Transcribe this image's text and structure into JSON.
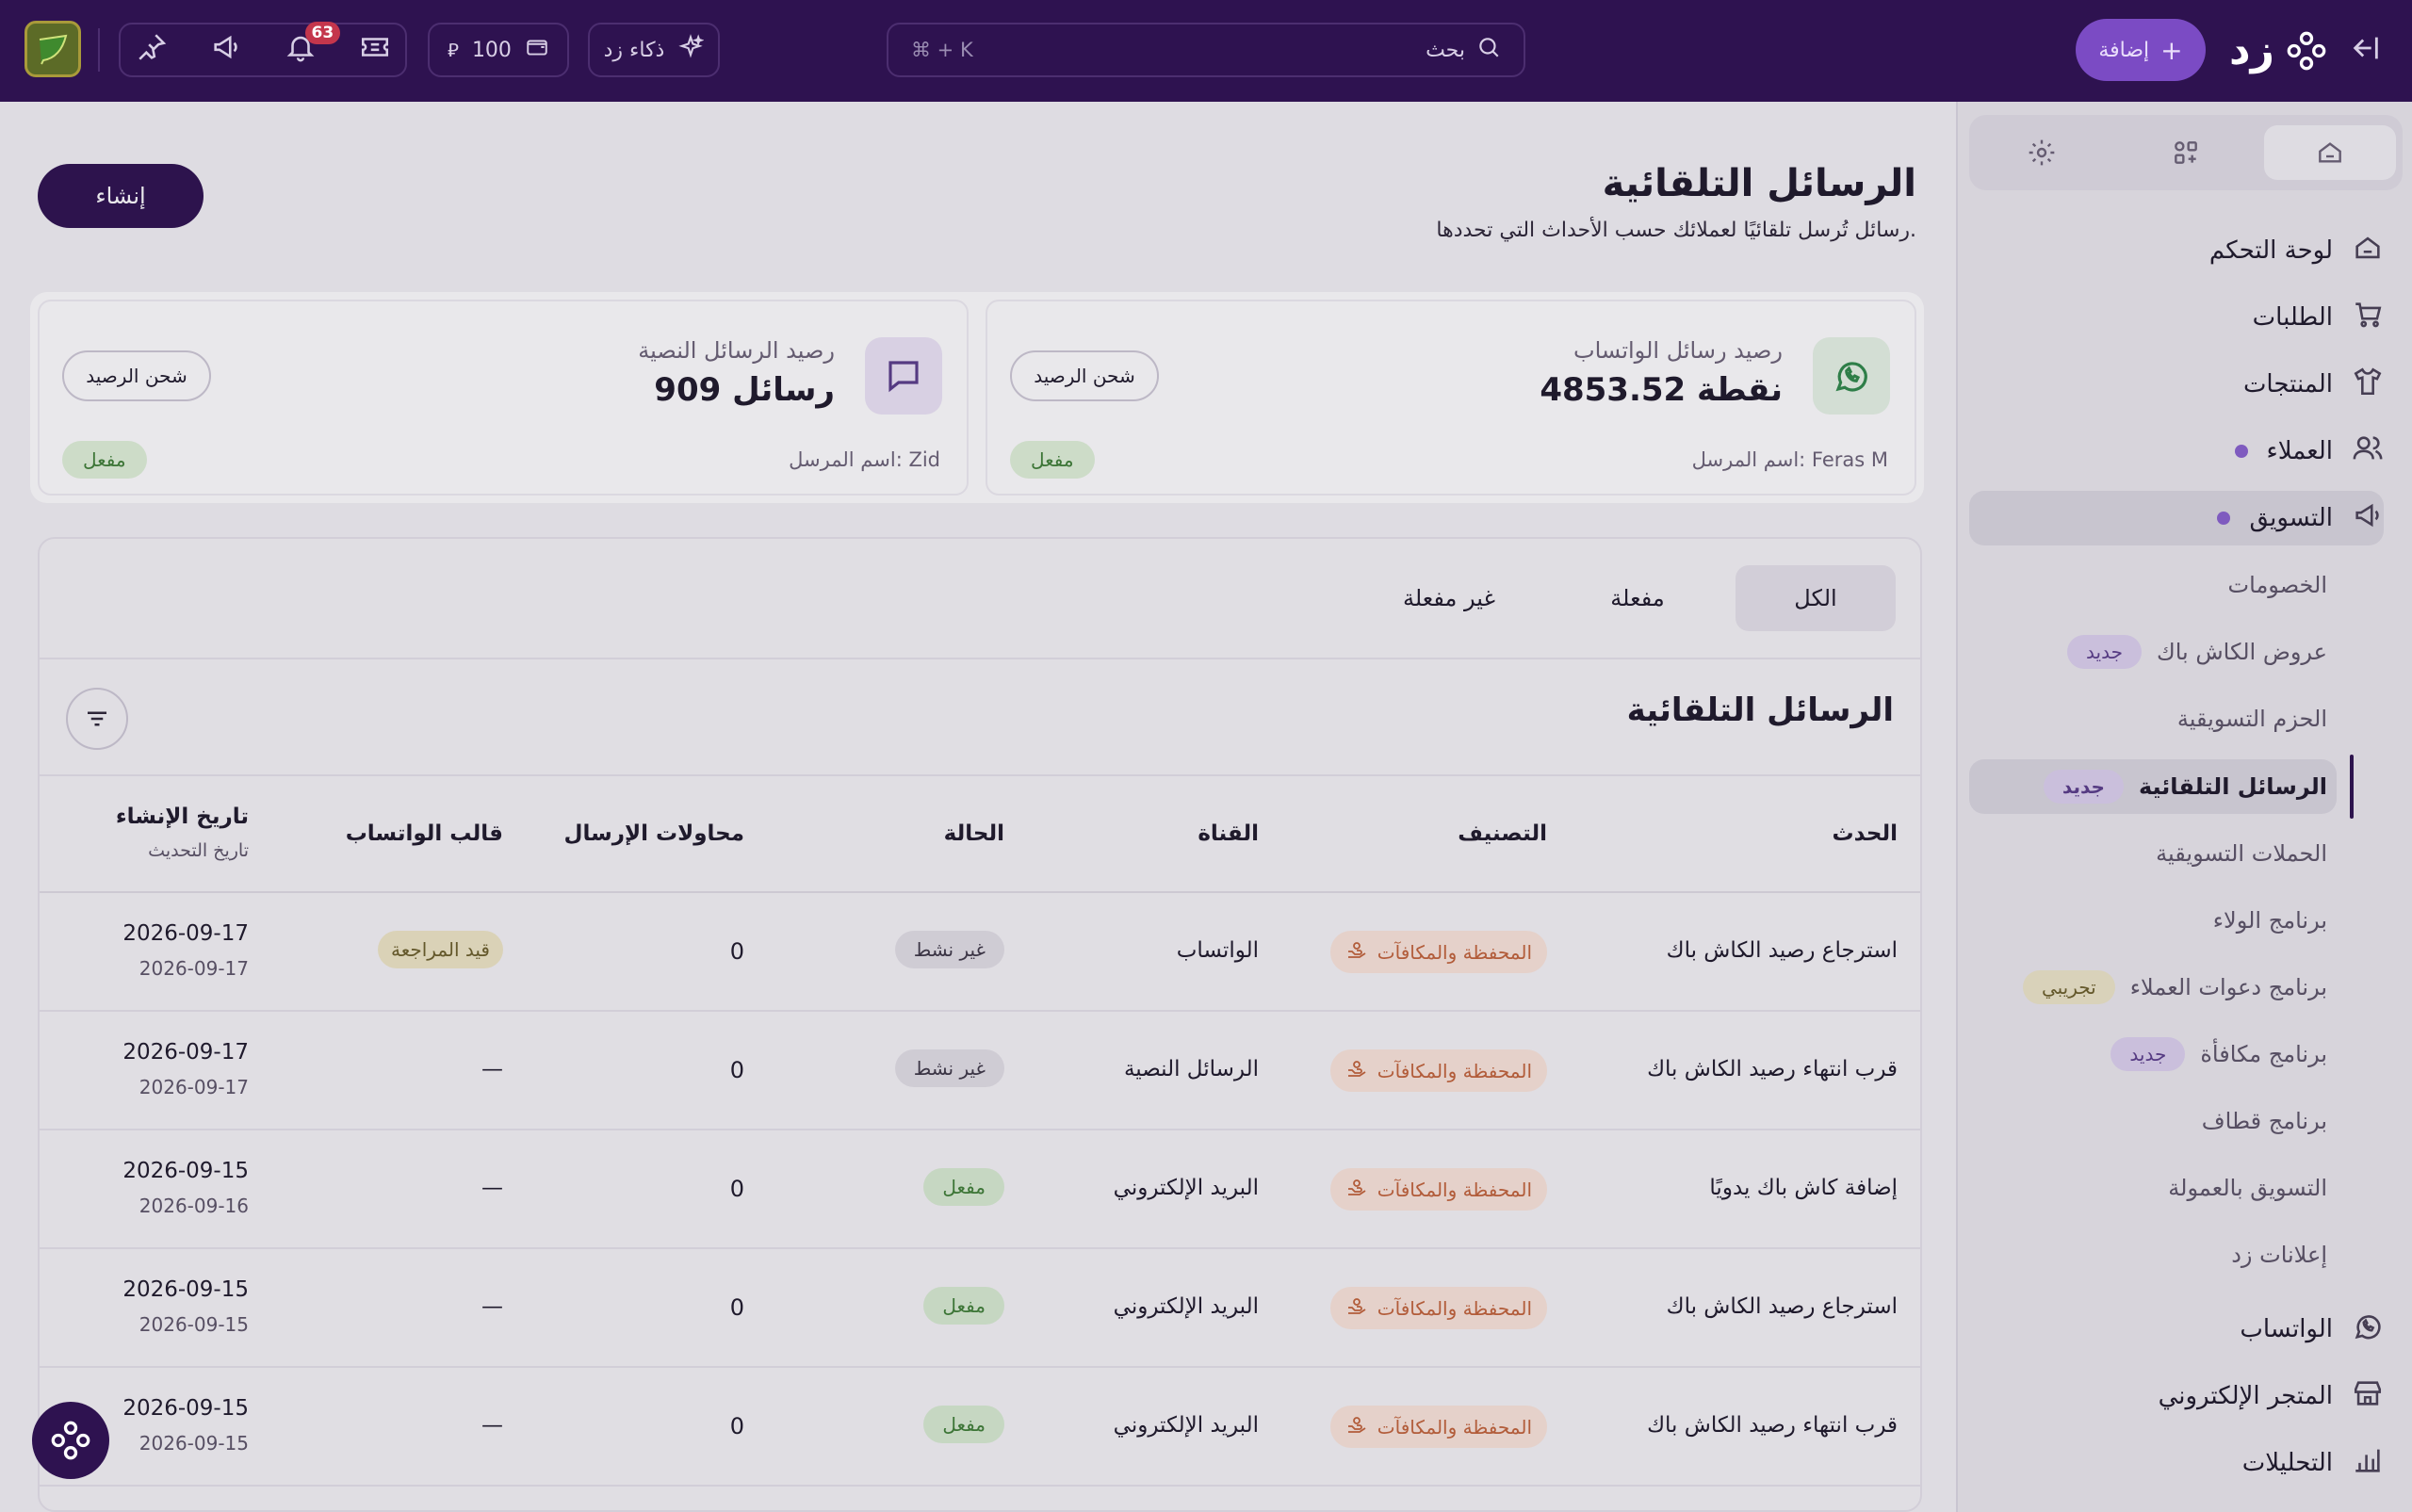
{
  "topbar": {
    "search_placeholder": "بحث",
    "search_shortcut": "⌘ + K",
    "add_label": "إضافة",
    "logo_text": "زد",
    "ai_label": "ذكاء زد",
    "balance_value": "100",
    "notifications_count": "63"
  },
  "sidebar": {
    "items": [
      {
        "label": "لوحة التحكم"
      },
      {
        "label": "الطلبات"
      },
      {
        "label": "المنتجات"
      },
      {
        "label": "العملاء"
      },
      {
        "label": "التسويق"
      }
    ],
    "marketing_sub": [
      {
        "label": "الخصومات"
      },
      {
        "label": "عروض الكاش باك",
        "badge": "جديد"
      },
      {
        "label": "الحزم التسويقية"
      },
      {
        "label": "الرسائل التلقائية",
        "badge": "جديد"
      },
      {
        "label": "الحملات التسويقية"
      },
      {
        "label": "برنامج الولاء"
      },
      {
        "label": "برنامج دعوات العملاء",
        "badge": "تجريبي"
      },
      {
        "label": "برنامج مكافأة",
        "badge": "جديد"
      },
      {
        "label": "برنامج قطاف"
      },
      {
        "label": "التسويق بالعمولة"
      },
      {
        "label": "إعلانات زد"
      }
    ],
    "bottom_items": [
      {
        "label": "الواتساب"
      },
      {
        "label": "المتجر الإلكتروني"
      },
      {
        "label": "التحليلات"
      }
    ]
  },
  "page": {
    "title": "الرسائل التلقائية",
    "subtitle": "رسائل تُرسل تلقائيًا لعملائك حسب الأحداث التي تحددها.",
    "create_label": "إنشاء"
  },
  "cards": {
    "whatsapp": {
      "label": "رصيد رسائل الواتساب",
      "value": "4853.52 نقطة",
      "sender": "اسم المرسل: Feras M",
      "charge_label": "شحن الرصيد",
      "status": "مفعل"
    },
    "sms": {
      "label": "رصيد الرسائل النصية",
      "value": "909 رسائل",
      "sender": "اسم المرسل: Zid",
      "charge_label": "شحن الرصيد",
      "status": "مفعل"
    }
  },
  "filters": {
    "all": "الكل",
    "active": "مفعلة",
    "inactive": "غير مفعلة"
  },
  "table": {
    "title": "الرسائل التلقائية",
    "headers": {
      "event": "الحدث",
      "category": "التصنيف",
      "channel": "القناة",
      "status": "الحالة",
      "attempts": "محاولات الإرسال",
      "template": "قالب الواتساب",
      "created": "تاريخ الإنشاء",
      "updated": "تاريخ التحديث"
    },
    "rows": [
      {
        "event": "استرجاع رصيد الكاش باك",
        "category": "المحفظة والمكافآت",
        "channel": "الواتساب",
        "status": "غير نشط",
        "attempts": "0",
        "template": "قيد المراجعة",
        "created": "2026-09-17",
        "updated": "2026-09-17"
      },
      {
        "event": "قرب انتهاء رصيد الكاش باك",
        "category": "المحفظة والمكافآت",
        "channel": "الرسائل النصية",
        "status": "غير نشط",
        "attempts": "0",
        "template": "—",
        "created": "2026-09-17",
        "updated": "2026-09-17"
      },
      {
        "event": "إضافة كاش باك يدويًا",
        "category": "المحفظة والمكافآت",
        "channel": "البريد الإلكتروني",
        "status": "مفعل",
        "attempts": "0",
        "template": "—",
        "created": "2026-09-15",
        "updated": "2026-09-16"
      },
      {
        "event": "استرجاع رصيد الكاش باك",
        "category": "المحفظة والمكافآت",
        "channel": "البريد الإلكتروني",
        "status": "مفعل",
        "attempts": "0",
        "template": "—",
        "created": "2026-09-15",
        "updated": "2026-09-15"
      },
      {
        "event": "قرب انتهاء رصيد الكاش باك",
        "category": "المحفظة والمكافآت",
        "channel": "البريد الإلكتروني",
        "status": "مفعل",
        "attempts": "0",
        "template": "—",
        "created": "2026-09-15",
        "updated": "2026-09-15"
      }
    ]
  }
}
